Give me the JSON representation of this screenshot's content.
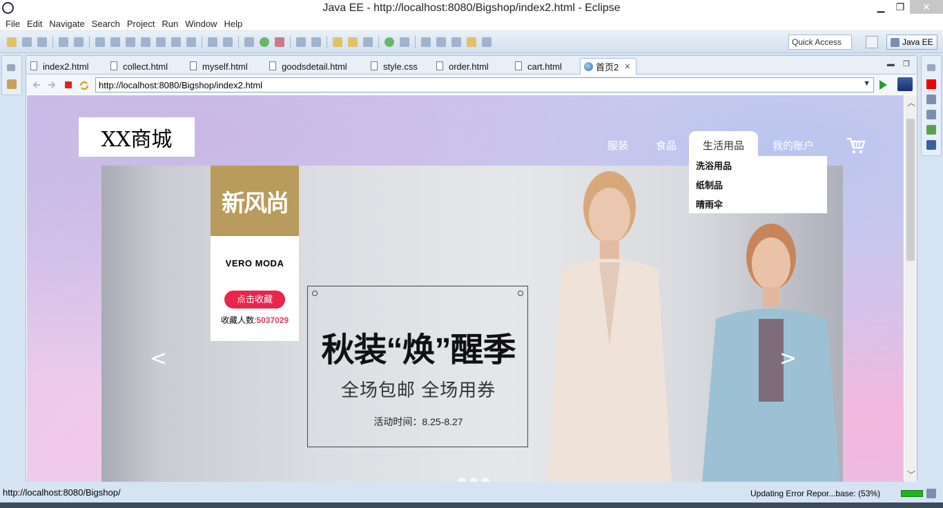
{
  "window": {
    "title": "Java EE - http://localhost:8080/Bigshop/index2.html - Eclipse"
  },
  "menu": [
    "File",
    "Edit",
    "Navigate",
    "Search",
    "Project",
    "Run",
    "Window",
    "Help"
  ],
  "toolbar": {
    "quick_access": "Quick Access",
    "perspective": "Java EE"
  },
  "tabs": [
    "index2.html",
    "collect.html",
    "myself.html",
    "goodsdetail.html",
    "style.css",
    "order.html",
    "cart.html",
    "首页2"
  ],
  "browser": {
    "url": "http://localhost:8080/Bigshop/index2.html"
  },
  "page": {
    "logo": "XX商城",
    "nav": [
      "服装",
      "食品",
      "生活用品",
      "我的账户"
    ],
    "dropdown": [
      "洗浴用品",
      "纸制品",
      "晴雨伞"
    ],
    "card": {
      "logo_text": "新风尚",
      "brand": "VERO MODA",
      "fav_button": "点击收藏",
      "count_label": "收藏人数:",
      "count_value": "5037029"
    },
    "promo": {
      "headline": "秋装“焕”醒季",
      "subline": "全场包邮 全场用券",
      "time": "活动时间：8.25-8.27"
    },
    "arrows": {
      "prev": "<",
      "next": ">"
    }
  },
  "status": {
    "hover_url": "http://localhost:8080/Bigshop/",
    "job": "Updating Error Repor...base: (53%)",
    "job_progress": 0.53
  }
}
